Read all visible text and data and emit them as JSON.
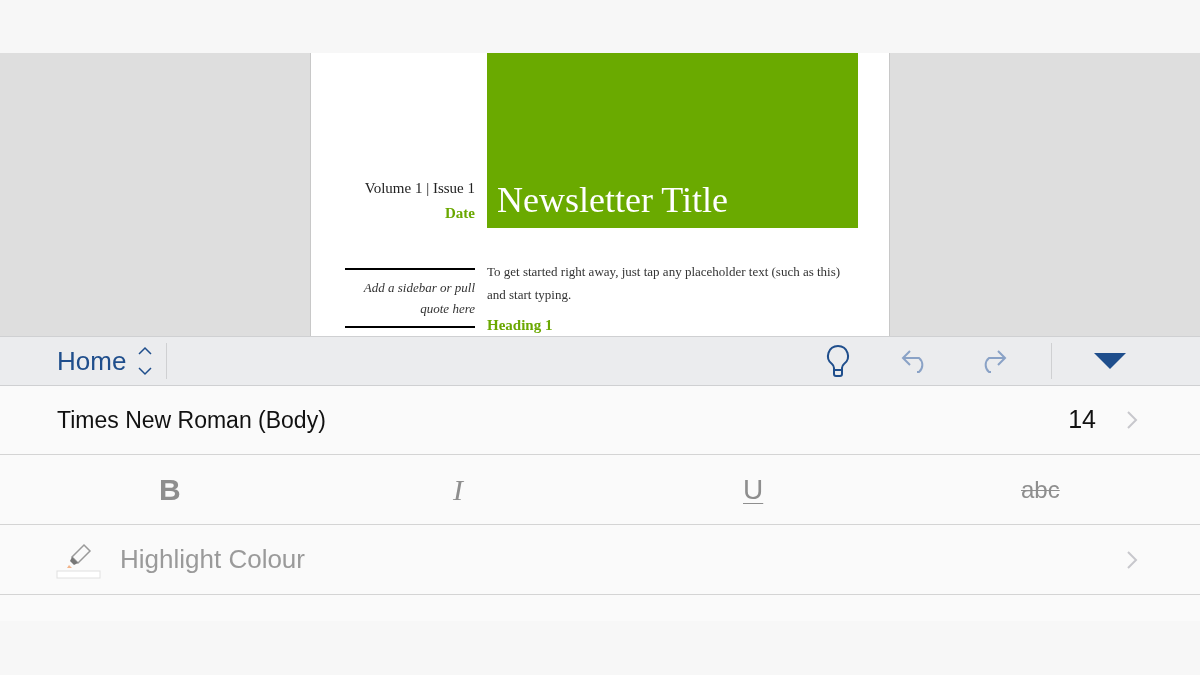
{
  "document": {
    "issue": "Volume 1 | Issue 1",
    "date": "Date",
    "title": "Newsletter Title",
    "sidebar_quote": "Add a sidebar or pull quote here",
    "body": "To get started right away, just tap any placeholder text (such as this) and start typing.",
    "heading": "Heading 1"
  },
  "ribbon": {
    "tab": "Home"
  },
  "font": {
    "name": "Times New Roman (Body)",
    "size": "14"
  },
  "format_buttons": [
    {
      "kind": "bold",
      "label": "B",
      "selected": false
    },
    {
      "kind": "italic",
      "label": "I",
      "selected": false
    },
    {
      "kind": "underline",
      "label": "U",
      "selected": false
    },
    {
      "kind": "strikethrough",
      "label": "abc",
      "selected": false
    }
  ],
  "rows": [
    {
      "label": "Highlight Colour",
      "disabled": true
    }
  ]
}
